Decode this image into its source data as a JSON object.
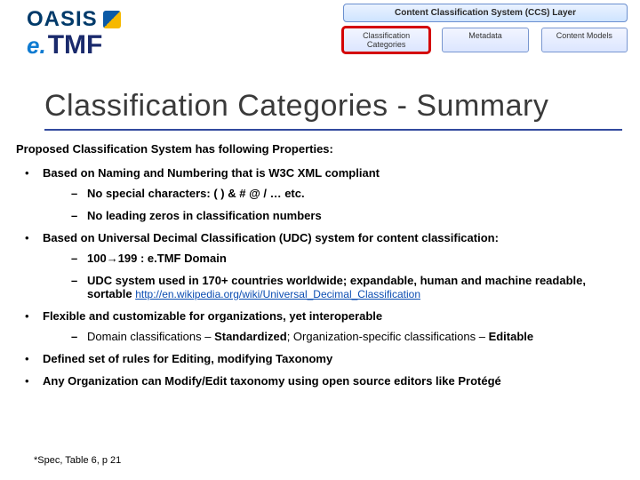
{
  "brand": {
    "oasis": "OASIS",
    "etmf_e": "e.",
    "etmf_tmf": "TMF"
  },
  "layers": {
    "ccs": "Content Classification System (CCS) Layer",
    "cells": {
      "categories": "Classification Categories",
      "metadata": "Metadata",
      "models": "Content Models"
    }
  },
  "title": "Classification Categories - Summary",
  "intro": "Proposed Classification System has following Properties:",
  "b1": "Based on Naming and Numbering that is W3C XML compliant",
  "b1_s1": "No special characters:  ( ) & # @ / … etc.",
  "b1_s2": "No leading zeros in classification numbers",
  "b2": "Based on Universal Decimal Classification (UDC) system for content classification:",
  "b2_s1": "100→199 :  e.TMF Domain",
  "b2_s2_prefix": "UDC system used in 170+ countries worldwide; expandable, human and machine readable, sortable   ",
  "b2_s2_link": "http://en.wikipedia.org/wiki/Universal_Decimal_Classification",
  "b3": "Flexible and customizable for organizations, yet interoperable",
  "b3_s1_a": "Domain classifications – ",
  "b3_s1_b": "Standardized",
  "b3_s1_c": "; Organization-specific classifications – ",
  "b3_s1_d": "Editable",
  "b4": "Defined set of rules for Editing, modifying Taxonomy",
  "b5": "Any Organization can Modify/Edit taxonomy using open source editors like Protégé",
  "footnote": "*Spec, Table 6, p 21"
}
